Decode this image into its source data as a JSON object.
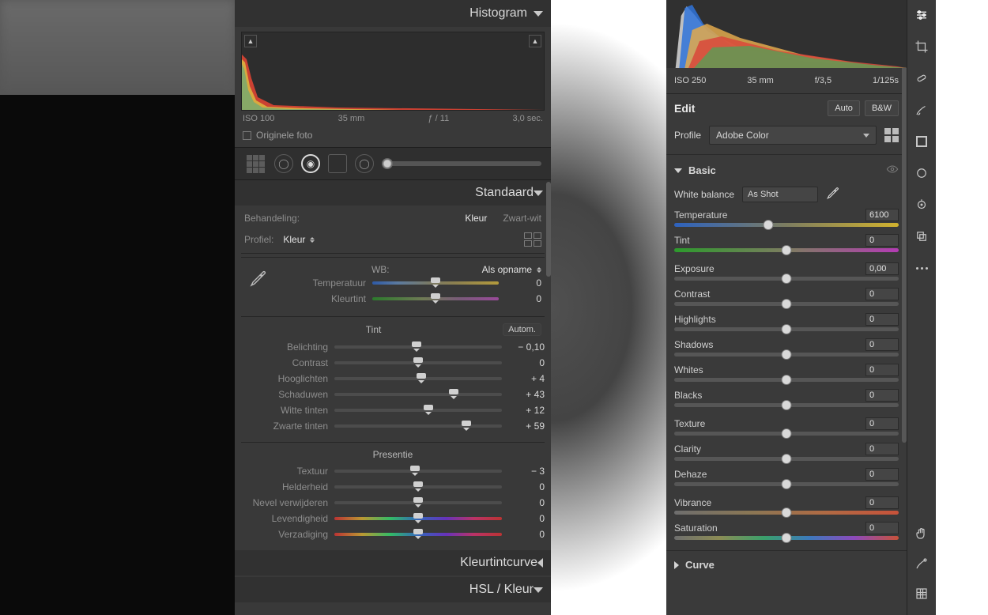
{
  "lc": {
    "histogram": {
      "title": "Histogram",
      "iso": "ISO 100",
      "focal": "35 mm",
      "aperture": "ƒ / 11",
      "shutter": "3,0 sec.",
      "original_label": "Originele foto"
    },
    "standard": {
      "title": "Standaard",
      "behandeling_label": "Behandeling:",
      "treat_color": "Kleur",
      "treat_bw": "Zwart-wit",
      "profile_label": "Profiel:",
      "profile_value": "Kleur",
      "wb_label": "WB:",
      "wb_value": "Als opname"
    },
    "sliders": {
      "temperatuur": {
        "label": "Temperatuur",
        "value": "0",
        "pos": 50,
        "track": "t-temp"
      },
      "kleurtint": {
        "label": "Kleurtint",
        "value": "0",
        "pos": 50,
        "track": "t-tint"
      }
    },
    "tint_group": {
      "title": "Tint",
      "auto": "Autom.",
      "items": [
        {
          "label": "Belichting",
          "value": "− 0,10",
          "pos": 49
        },
        {
          "label": "Contrast",
          "value": "0",
          "pos": 50
        },
        {
          "label": "Hooglichten",
          "value": "+ 4",
          "pos": 52
        },
        {
          "label": "Schaduwen",
          "value": "+ 43",
          "pos": 71
        },
        {
          "label": "Witte tinten",
          "value": "+ 12",
          "pos": 56
        },
        {
          "label": "Zwarte tinten",
          "value": "+ 59",
          "pos": 79
        }
      ]
    },
    "presence_group": {
      "title": "Presentie",
      "items": [
        {
          "label": "Textuur",
          "value": "− 3",
          "pos": 48,
          "track": "t-gray"
        },
        {
          "label": "Helderheid",
          "value": "0",
          "pos": 50,
          "track": "t-gray"
        },
        {
          "label": "Nevel verwijderen",
          "value": "0",
          "pos": 50,
          "track": "t-gray"
        },
        {
          "label": "Levendigheid",
          "value": "0",
          "pos": 50,
          "track": "t-hue"
        },
        {
          "label": "Verzadiging",
          "value": "0",
          "pos": 50,
          "track": "t-hue"
        }
      ]
    },
    "kleurtintcurve": "Kleurtintcurve",
    "hsl": "HSL / Kleur"
  },
  "lr": {
    "meta": {
      "iso": "ISO 250",
      "focal": "35 mm",
      "aperture": "f/3,5",
      "shutter": "1/125s"
    },
    "edit_title": "Edit",
    "auto": "Auto",
    "bw": "B&W",
    "profile_label": "Profile",
    "profile_value": "Adobe Color",
    "basic": {
      "title": "Basic",
      "wb_label": "White balance",
      "wb_value": "As Shot",
      "sliders": [
        {
          "name": "Temperature",
          "value": "6100",
          "pos": 42,
          "track": "t2-temp"
        },
        {
          "name": "Tint",
          "value": "0",
          "pos": 50,
          "track": "t2-tint"
        }
      ],
      "tone": [
        {
          "name": "Exposure",
          "value": "0,00",
          "pos": 50
        },
        {
          "name": "Contrast",
          "value": "0",
          "pos": 50
        },
        {
          "name": "Highlights",
          "value": "0",
          "pos": 50
        },
        {
          "name": "Shadows",
          "value": "0",
          "pos": 50
        },
        {
          "name": "Whites",
          "value": "0",
          "pos": 50
        },
        {
          "name": "Blacks",
          "value": "0",
          "pos": 50
        }
      ],
      "presence": [
        {
          "name": "Texture",
          "value": "0",
          "pos": 50,
          "track": "t2-gray"
        },
        {
          "name": "Clarity",
          "value": "0",
          "pos": 50,
          "track": "t2-gray"
        },
        {
          "name": "Dehaze",
          "value": "0",
          "pos": 50,
          "track": "t2-gray"
        }
      ],
      "color": [
        {
          "name": "Vibrance",
          "value": "0",
          "pos": 50,
          "track": "t2-vib"
        },
        {
          "name": "Saturation",
          "value": "0",
          "pos": 50,
          "track": "t2-sat"
        }
      ]
    },
    "curve_title": "Curve"
  }
}
